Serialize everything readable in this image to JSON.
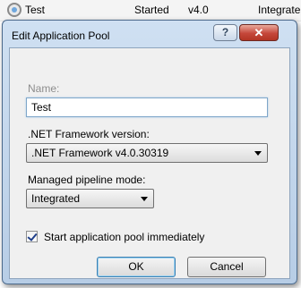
{
  "background_row": {
    "name": "Test",
    "status": "Started",
    "version": "v4.0",
    "pipeline": "Integrate"
  },
  "dialog": {
    "title": "Edit Application Pool",
    "help_label": "?",
    "close_label": "✕",
    "name_label": "Name:",
    "name_value": "Test",
    "framework_label": ".NET Framework version:",
    "framework_value": ".NET Framework v4.0.30319",
    "pipeline_label": "Managed pipeline mode:",
    "pipeline_value": "Integrated",
    "start_immediately_label": "Start application pool immediately",
    "start_immediately_checked": true,
    "ok_label": "OK",
    "cancel_label": "Cancel"
  },
  "colors": {
    "title_gradient_top": "#cfe0f2",
    "close_button": "#c5473a",
    "client_bg": "#f0f0f0"
  },
  "icons": [
    "app-pool-icon",
    "help-icon",
    "close-icon",
    "dropdown-arrow-icon",
    "checkmark-icon"
  ]
}
